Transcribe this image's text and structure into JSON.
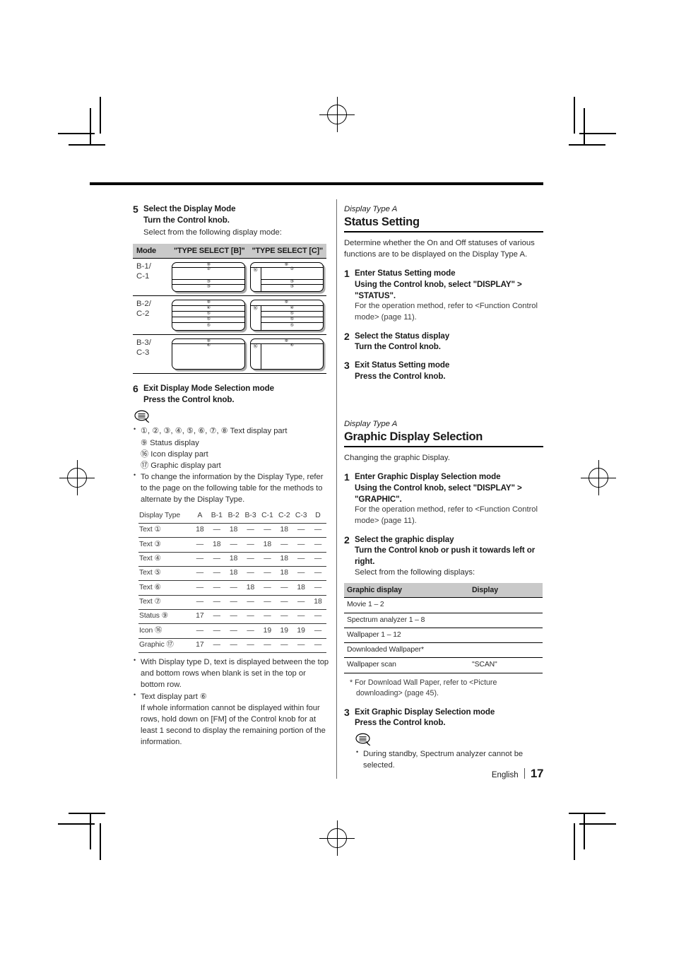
{
  "footer": {
    "language": "English",
    "page_number": "17"
  },
  "left_column": {
    "step5": {
      "num": "5",
      "title": "Select the Display Mode",
      "subtitle": "Turn the Control knob.",
      "note": "Select from the following display mode:"
    },
    "mode_table": {
      "headers": [
        "Mode",
        "\"TYPE SELECT [B]\"",
        "\"TYPE SELECT [C]\""
      ],
      "rows": [
        {
          "mode": "B-1/\nC-1",
          "type_b": {
            "icon_col": false,
            "rows": [
              {
                "num": "⑨",
                "h": 7
              },
              {
                "num": "②",
                "h": 17
              },
              {
                "num": "③",
                "h": 7
              },
              {
                "num": "③",
                "h": 7
              }
            ]
          },
          "type_c": {
            "icon_col": true,
            "icon_num": "⑯",
            "rows": [
              {
                "num": "⑨",
                "h": 7
              },
              {
                "num": "②",
                "h": 17
              },
              {
                "num": "③",
                "h": 7
              },
              {
                "num": "③",
                "h": 7
              }
            ]
          }
        },
        {
          "mode": "B-2/\nC-2",
          "type_b": {
            "icon_col": false,
            "rows": [
              {
                "num": "⑨",
                "h": 8
              },
              {
                "num": "④",
                "h": 8
              },
              {
                "num": "⑤",
                "h": 8
              },
              {
                "num": "⑤",
                "h": 8
              },
              {
                "num": "⑤",
                "h": 8
              }
            ]
          },
          "type_c": {
            "icon_col": true,
            "icon_num": "⑯",
            "rows": [
              {
                "num": "⑨",
                "h": 8
              },
              {
                "num": "④",
                "h": 8
              },
              {
                "num": "⑤",
                "h": 8
              },
              {
                "num": "⑤",
                "h": 8
              },
              {
                "num": "⑤",
                "h": 8
              }
            ]
          }
        },
        {
          "mode": "B-3/\nC-3",
          "type_b": {
            "icon_col": false,
            "rows": [
              {
                "num": "⑨",
                "h": 7
              },
              {
                "num": "⑥",
                "h": 33
              }
            ]
          },
          "type_c": {
            "icon_col": true,
            "icon_num": "⑯",
            "rows": [
              {
                "num": "⑨",
                "h": 7
              },
              {
                "num": "⑥",
                "h": 33
              }
            ]
          }
        }
      ]
    },
    "step6": {
      "num": "6",
      "title": "Exit Display Mode Selection mode",
      "subtitle": "Press the Control knob."
    },
    "memo_bullets": [
      "①, ②, ③, ④, ⑤, ⑥, ⑦, ⑧ Text display part",
      "To change the information by the Display Type, refer to the page on the following table for the methods to alternate by the Display Type."
    ],
    "memo_sublines": [
      "⑨ Status display",
      "⑯ Icon display part",
      "⑰ Graphic display part"
    ],
    "display_type_table": {
      "headers": [
        "Display Type",
        "A",
        "B-1",
        "B-2",
        "B-3",
        "C-1",
        "C-2",
        "C-3",
        "D"
      ],
      "rows": [
        {
          "label": "Text ①",
          "values": [
            "18",
            "—",
            "18",
            "—",
            "—",
            "18",
            "—",
            "—"
          ]
        },
        {
          "label": "Text ③",
          "values": [
            "—",
            "18",
            "—",
            "—",
            "18",
            "—",
            "—",
            "—"
          ]
        },
        {
          "label": "Text ④",
          "values": [
            "—",
            "—",
            "18",
            "—",
            "—",
            "18",
            "—",
            "—"
          ]
        },
        {
          "label": "Text ⑤",
          "values": [
            "—",
            "—",
            "18",
            "—",
            "—",
            "18",
            "—",
            "—"
          ]
        },
        {
          "label": "Text ⑥",
          "values": [
            "—",
            "—",
            "—",
            "18",
            "—",
            "—",
            "18",
            "—"
          ]
        },
        {
          "label": "Text ⑦",
          "values": [
            "—",
            "—",
            "—",
            "—",
            "—",
            "—",
            "—",
            "18"
          ]
        },
        {
          "label": "Status ⑨",
          "values": [
            "17",
            "—",
            "—",
            "—",
            "—",
            "—",
            "—",
            "—"
          ]
        },
        {
          "label": "Icon ⑯",
          "values": [
            "—",
            "—",
            "—",
            "—",
            "19",
            "19",
            "19",
            "—"
          ]
        },
        {
          "label": "Graphic ⑰",
          "values": [
            "17",
            "—",
            "—",
            "—",
            "—",
            "—",
            "—",
            "—"
          ]
        }
      ]
    },
    "bottom_bullets": [
      "With Display type D, text is displayed between the top and bottom rows when blank is set in the top or bottom row.",
      "Text display part ⑥"
    ],
    "bottom_subline": "If whole information cannot be displayed within four rows, hold down on [FM] of the Control knob for at least 1 second to display the remaining portion of the information."
  },
  "right_column": {
    "status_setting": {
      "display_type": "Display Type A",
      "title": "Status Setting",
      "intro": "Determine whether the On and Off statuses of various functions are to be displayed on the Display Type A.",
      "steps": [
        {
          "num": "1",
          "title": "Enter Status Setting mode",
          "subtitle": "Using the Control knob, select \"DISPLAY\" > \"STATUS\".",
          "note": "For the operation method, refer to <Function Control mode> (page 11)."
        },
        {
          "num": "2",
          "title": "Select the Status display",
          "subtitle": "Turn the Control knob.",
          "note": ""
        },
        {
          "num": "3",
          "title": "Exit Status Setting mode",
          "subtitle": "Press the Control knob.",
          "note": ""
        }
      ]
    },
    "graphic_display": {
      "display_type": "Display Type A",
      "title": "Graphic Display Selection",
      "intro": "Changing the graphic Display.",
      "step1": {
        "num": "1",
        "title": "Enter Graphic Display Selection mode",
        "subtitle": "Using the Control knob, select \"DISPLAY\" > \"GRAPHIC\".",
        "note": "For the operation method, refer to <Function Control mode> (page 11)."
      },
      "step2": {
        "num": "2",
        "title": "Select the graphic display",
        "subtitle": "Turn the Control knob or push it towards left or right.",
        "note": "Select from the following displays:"
      },
      "table": {
        "headers": [
          "Graphic display",
          "Display"
        ],
        "rows": [
          {
            "name": "Movie 1 – 2",
            "display": ""
          },
          {
            "name": "Spectrum analyzer 1 – 8",
            "display": ""
          },
          {
            "name": "Wallpaper 1 – 12",
            "display": ""
          },
          {
            "name": "Downloaded Wallpaper*",
            "display": ""
          },
          {
            "name": "Wallpaper scan",
            "display": "\"SCAN\""
          }
        ]
      },
      "footnote": "* For Download Wall Paper, refer to <Picture downloading> (page 45).",
      "step3": {
        "num": "3",
        "title": "Exit Graphic Display Selection mode",
        "subtitle": "Press the Control knob."
      },
      "memo_bullet": "During standby, Spectrum analyzer cannot be selected."
    }
  }
}
